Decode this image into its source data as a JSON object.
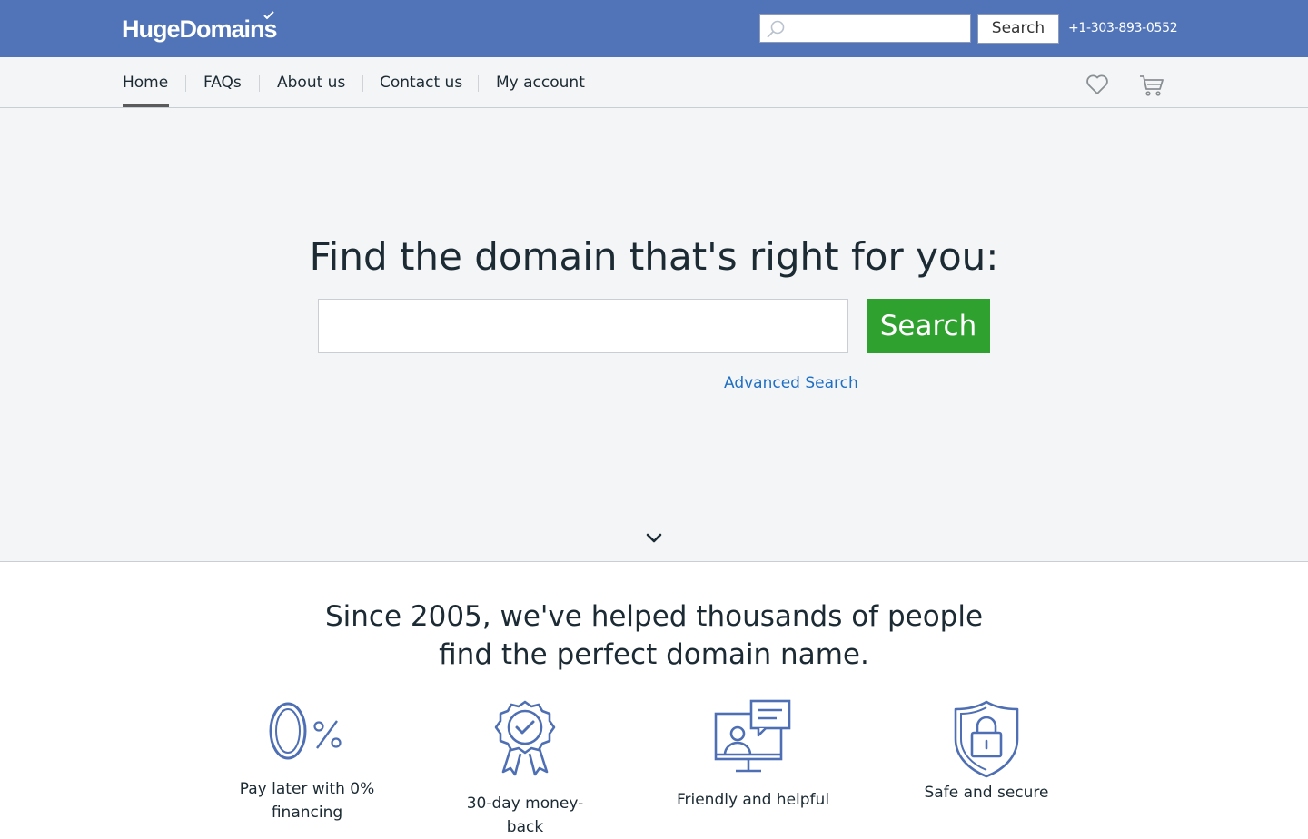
{
  "header": {
    "logo_text": "HugeDomains",
    "search_placeholder": "",
    "search_button": "Search",
    "phone": "+1-303-893-0552"
  },
  "nav": {
    "items": [
      {
        "label": "Home"
      },
      {
        "label": "FAQs"
      },
      {
        "label": "About us"
      },
      {
        "label": "Contact us"
      },
      {
        "label": "My account"
      }
    ],
    "active": "Home"
  },
  "hero": {
    "title": "Find the domain that's right for you:",
    "search_value": "",
    "search_button": "Search",
    "advanced_link": "Advanced Search"
  },
  "intro": {
    "line1": "Since 2005, we've helped thousands of people",
    "line2": "find the perfect domain name."
  },
  "features": [
    {
      "icon": "zero-percent-icon",
      "label_line1": "Pay later with 0%",
      "label_line2": "financing"
    },
    {
      "icon": "award-ribbon-icon",
      "label_line1": "30-day money-back",
      "label_line2": ""
    },
    {
      "icon": "support-monitor-icon",
      "label_line1": "Friendly and helpful",
      "label_line2": ""
    },
    {
      "icon": "shield-lock-icon",
      "label_line1": "Safe and secure",
      "label_line2": ""
    }
  ],
  "colors": {
    "header_bg": "#5074b7",
    "accent_green": "#2fa12f",
    "link_blue": "#1f6fc5",
    "icon_blue": "#4e6fb3"
  }
}
